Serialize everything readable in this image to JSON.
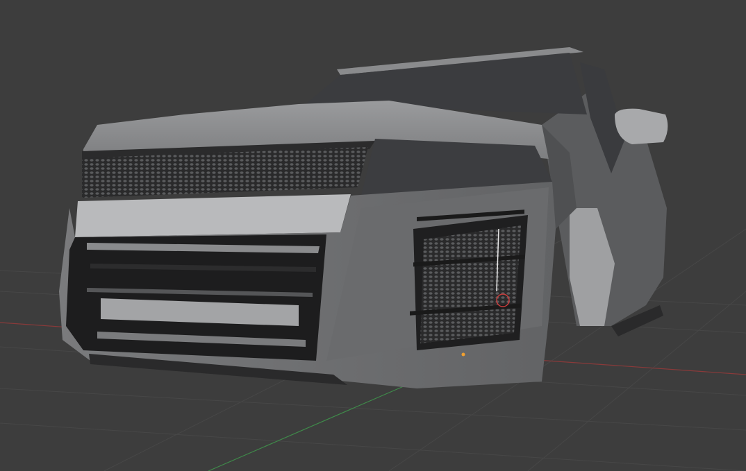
{
  "viewport": {
    "background": "#3d3d3d",
    "grid_color": "#474747",
    "x_axis_color": "#8a3a3a",
    "y_axis_color": "#3f8a4a"
  },
  "model": {
    "body_color": "#6f7072",
    "light_panel_color": "#b9babc",
    "dark_color": "#1f1f20",
    "glass_color": "#3b3c3f"
  },
  "cursor": {
    "icon": "3d-cursor-icon",
    "ring_color": "#c83c3c"
  },
  "origin": {
    "icon": "object-origin-dot",
    "color": "#f0a030"
  }
}
